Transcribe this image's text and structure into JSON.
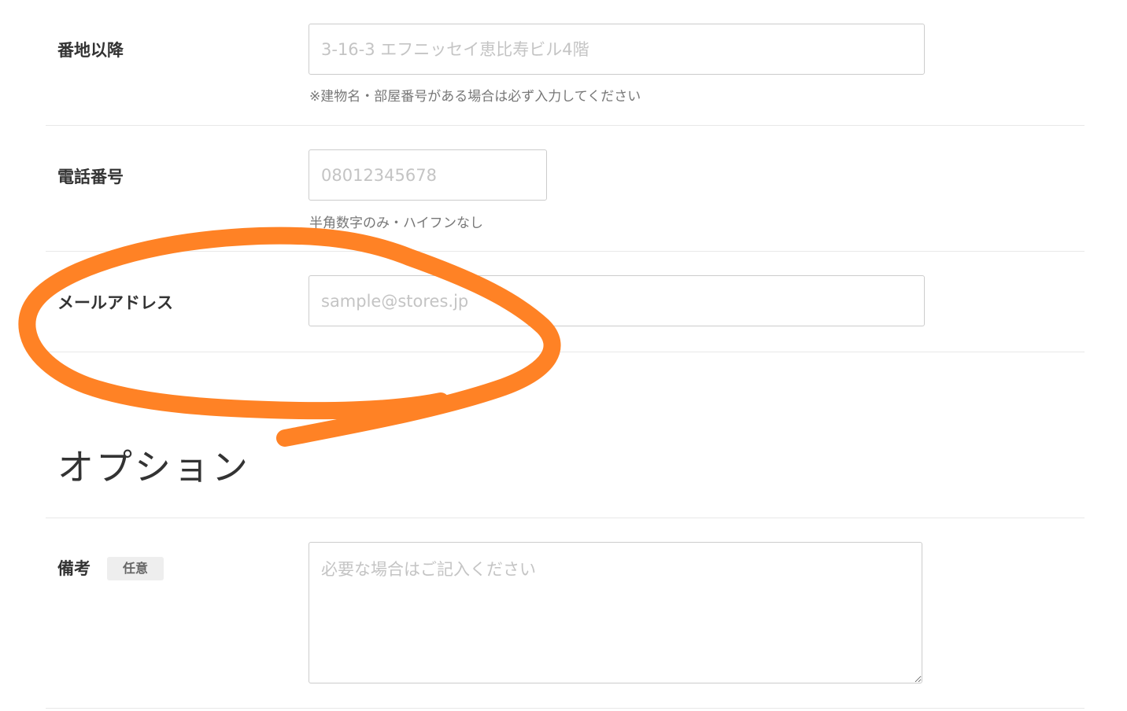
{
  "address_detail": {
    "label": "番地以降",
    "placeholder": "3-16-3 エフニッセイ恵比寿ビル4階",
    "hint": "※建物名・部屋番号がある場合は必ず入力してください"
  },
  "phone": {
    "label": "電話番号",
    "placeholder": "08012345678",
    "hint": "半角数字のみ・ハイフンなし"
  },
  "email": {
    "label": "メールアドレス",
    "placeholder": "sample@stores.jp"
  },
  "options_section": {
    "title": "オプション"
  },
  "remarks": {
    "label": "備考",
    "badge": "任意",
    "placeholder": "必要な場合はご記入ください"
  },
  "annotation": {
    "stroke_color": "#ff8225"
  }
}
